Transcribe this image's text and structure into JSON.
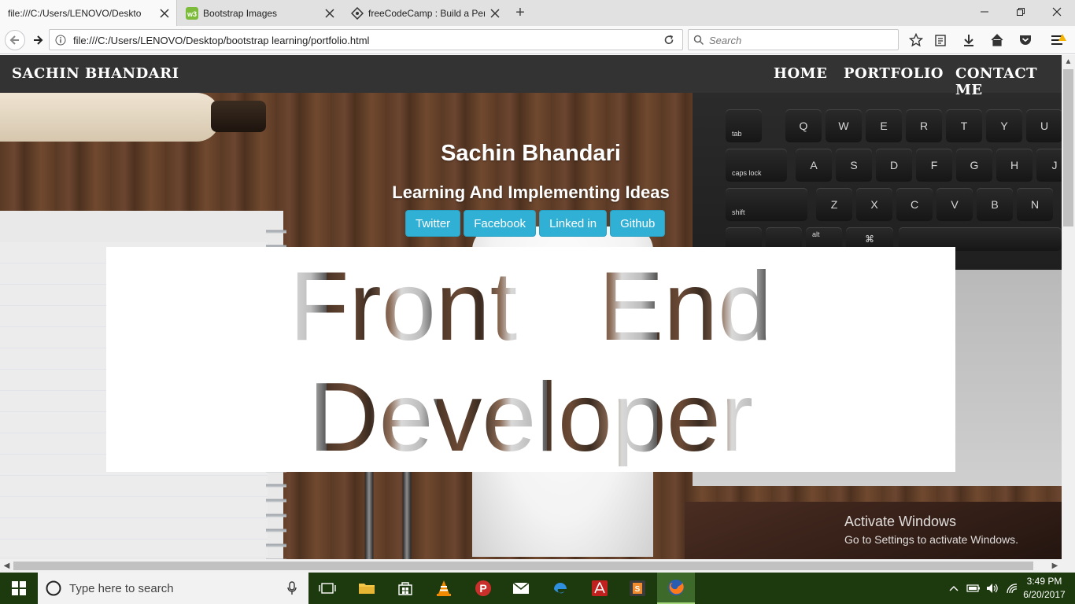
{
  "browser": {
    "tabs": [
      {
        "title": "file:///C:/Users/LENOVO/Deskto",
        "active": true
      },
      {
        "title": "Bootstrap Images",
        "active": false
      },
      {
        "title": "freeCodeCamp : Build a Pers",
        "active": false
      }
    ],
    "url": "file:///C:/Users/LENOVO/Desktop/bootstrap learning/portfolio.html",
    "search_placeholder": "Search"
  },
  "site": {
    "brand": "SACHIN BHANDARI",
    "nav": [
      "HOME",
      "PORTFOLIO",
      "CONTACT ME"
    ],
    "hero": {
      "name": "Sachin Bhandari",
      "tagline": "Learning And Implementing Ideas",
      "buttons": [
        "Twitter",
        "Facebook",
        "Linked in",
        "Github"
      ],
      "headline_line1": "Front   End",
      "headline_line2": "Developer"
    },
    "keyboard": {
      "row1": [
        "Q",
        "W",
        "E",
        "R",
        "T",
        "Y",
        "U"
      ],
      "row2": [
        "A",
        "S",
        "D",
        "F",
        "G",
        "H",
        "J"
      ],
      "row3": [
        "Z",
        "X",
        "C",
        "V",
        "B",
        "N"
      ],
      "tab_label": "tab",
      "capslock_label": "caps lock",
      "shift_label": "shift",
      "alt_label": "alt",
      "cmd_label": "⌘"
    }
  },
  "watermark": {
    "line1": "Activate Windows",
    "line2": "Go to Settings to activate Windows."
  },
  "taskbar": {
    "search_placeholder": "Type here to search",
    "time": "3:49 PM",
    "date": "6/20/2017"
  },
  "colors": {
    "site_nav_bg": "#333333",
    "social_button": "#31b0d5",
    "taskbar_bg": "#1d3a0f"
  }
}
